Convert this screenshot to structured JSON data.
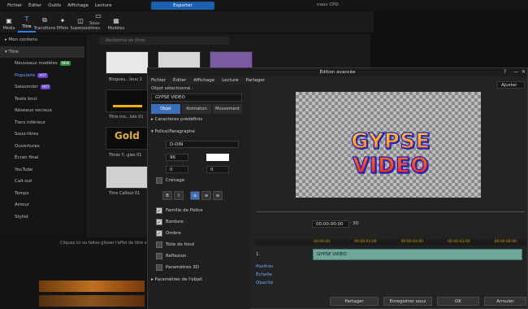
{
  "menu": {
    "items": [
      "Fichier",
      "Éditer",
      "Outils",
      "Affichage",
      "Lecture"
    ],
    "export": "Exporter",
    "project": "nouv CPD"
  },
  "toolbar": [
    {
      "label": "Média",
      "icon": "media-icon"
    },
    {
      "label": "Titre",
      "icon": "title-icon"
    },
    {
      "label": "Transitions",
      "icon": "transitions-icon"
    },
    {
      "label": "Effets",
      "icon": "effects-icon"
    },
    {
      "label": "Superpos.",
      "icon": "overlay-icon"
    },
    {
      "label": "Sous-titres",
      "icon": "subtitles-icon"
    },
    {
      "label": "Modèles",
      "icon": "templates-icon"
    }
  ],
  "sidebar": {
    "items": [
      {
        "label": "▸ Mon contenu"
      },
      {
        "label": "▾ Titre"
      },
      {
        "label": "Nouveaux modèles",
        "badge": "NEW",
        "badge_color": "green"
      },
      {
        "label": "Populaire",
        "badge": "HOT",
        "badge_color": "purple"
      },
      {
        "label": "Saisonnier",
        "badge": "HOT",
        "badge_color": "purple"
      },
      {
        "label": "Texte brut"
      },
      {
        "label": "Réseaux sociaux"
      },
      {
        "label": "Tiers inférieur"
      },
      {
        "label": "Sous-titres"
      },
      {
        "label": "Ouvertures"
      },
      {
        "label": "Écran final"
      },
      {
        "label": "YouTube"
      },
      {
        "label": "Call-out"
      },
      {
        "label": "Temps"
      },
      {
        "label": "Amour"
      },
      {
        "label": "Stylist"
      }
    ]
  },
  "library": {
    "search_placeholder": "Recherche de titres",
    "thumbs": [
      {
        "label": "Blogueu...Ieuu 1"
      },
      {
        "label": "Titre mo...luts 01"
      },
      {
        "label": "Titres Y...gles 01"
      },
      {
        "label": "Titre Callout 01"
      }
    ],
    "gold_text": "Gold"
  },
  "timeline": {
    "hint": "Cliquez ici ou faites glisser l'effet de titre sélectionné"
  },
  "dialog": {
    "title": "Édition avancée",
    "menu": [
      "Fichier",
      "Éditer",
      "Affichage",
      "Lecture",
      "Partager"
    ],
    "selected_label": "Objet sélectionné :",
    "selected_value": "GYPSE VIDEO",
    "tabs": [
      "Objet",
      "Animation",
      "Mouvement"
    ],
    "sections": [
      "Caractères prédéfinis",
      "Police/Paragraphe"
    ],
    "font": "D-DIN",
    "size": "96",
    "spacing1": "0",
    "spacing2": "0",
    "kerning": "Crénage",
    "options": [
      {
        "label": "Famille de Police",
        "checked": true
      },
      {
        "label": "Bordure",
        "checked": true
      },
      {
        "label": "Ombre",
        "checked": true
      },
      {
        "label": "Toile de fond",
        "checked": false
      },
      {
        "label": "Réflexion",
        "checked": false
      },
      {
        "label": "Paramètres 3D",
        "checked": false
      }
    ],
    "object_params": "Paramètres de l'objet",
    "zoom": "Ajuster",
    "preview_text": "GYPSE VIDEO",
    "timecode": "00:00:00:00",
    "mode": "3D",
    "ruler": [
      "00:00:00",
      "00:00:01:00",
      "00:00:02:00",
      "00:00:03:00",
      "00:00:04:00"
    ],
    "track_clip": "GYPSE VIDEO",
    "track_labels": [
      "Position",
      "Échelle",
      "Opacité"
    ],
    "track_num": "1.",
    "buttons": [
      "Partager",
      "Enregistrer sous",
      "OK",
      "Annuler"
    ]
  },
  "colors": {
    "accent": "#2a7fff",
    "export": "#1a5fb0"
  }
}
